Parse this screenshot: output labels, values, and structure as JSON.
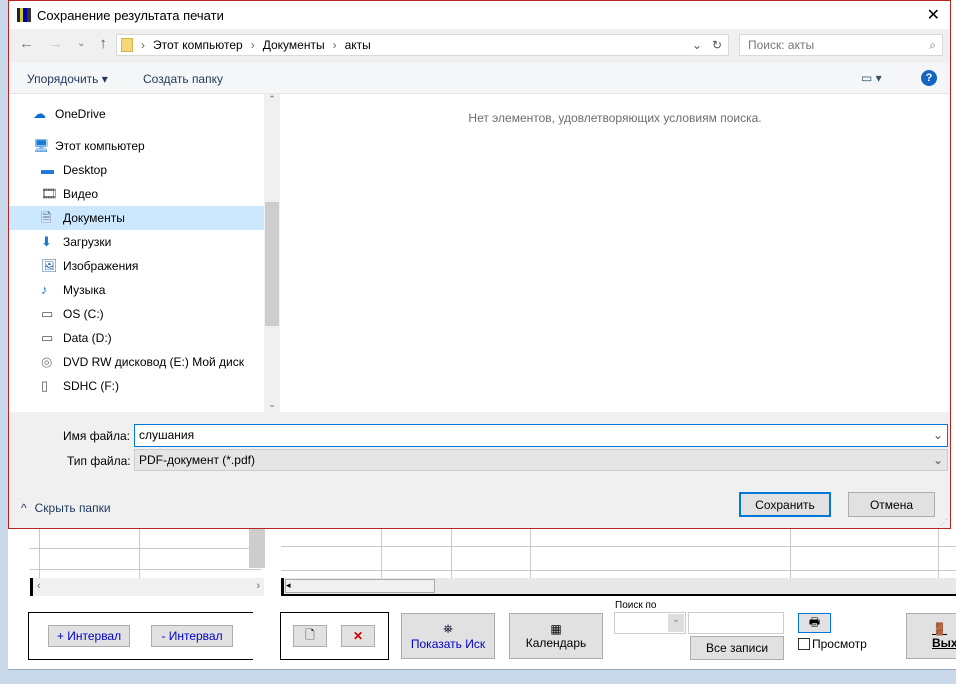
{
  "dialog": {
    "title": "Сохранение результата печати",
    "address": {
      "crumbs": [
        "Этот компьютер",
        "Документы",
        "акты"
      ],
      "search_placeholder": "Поиск: акты"
    },
    "toolbar": {
      "organize": "Упорядочить",
      "new_folder": "Создать папку"
    },
    "nav": [
      {
        "label": "OneDrive",
        "icon": "cloud-icon"
      },
      {
        "label": "Этот компьютер",
        "icon": "computer-icon"
      },
      {
        "label": "Desktop",
        "icon": "desktop-icon"
      },
      {
        "label": "Видео",
        "icon": "video-icon"
      },
      {
        "label": "Документы",
        "icon": "documents-icon",
        "selected": true
      },
      {
        "label": "Загрузки",
        "icon": "download-icon"
      },
      {
        "label": "Изображения",
        "icon": "pictures-icon"
      },
      {
        "label": "Музыка",
        "icon": "music-icon"
      },
      {
        "label": "OS (C:)",
        "icon": "drive-icon"
      },
      {
        "label": "Data (D:)",
        "icon": "drive-icon"
      },
      {
        "label": "DVD RW дисковод (E:) Мой диск",
        "icon": "dvd-icon"
      },
      {
        "label": "SDHC (F:)",
        "icon": "sd-card-icon"
      }
    ],
    "empty_message": "Нет элементов, удовлетворяющих условиям поиска.",
    "filename_label": "Имя файла:",
    "filename_value": "слушания",
    "filetype_label": "Тип файла:",
    "filetype_value": "PDF-документ (*.pdf)",
    "hide_folders": "Скрыть папки",
    "save": "Сохранить",
    "cancel": "Отмена"
  },
  "app": {
    "plus_interval": "+ Интервал",
    "minus_interval": "- Интервал",
    "show_claim": "Показать Иск",
    "calendar": "Календарь",
    "search_by": "Поиск по",
    "all_records": "Все записи",
    "preview": "Просмотр",
    "exit": "Выход"
  }
}
